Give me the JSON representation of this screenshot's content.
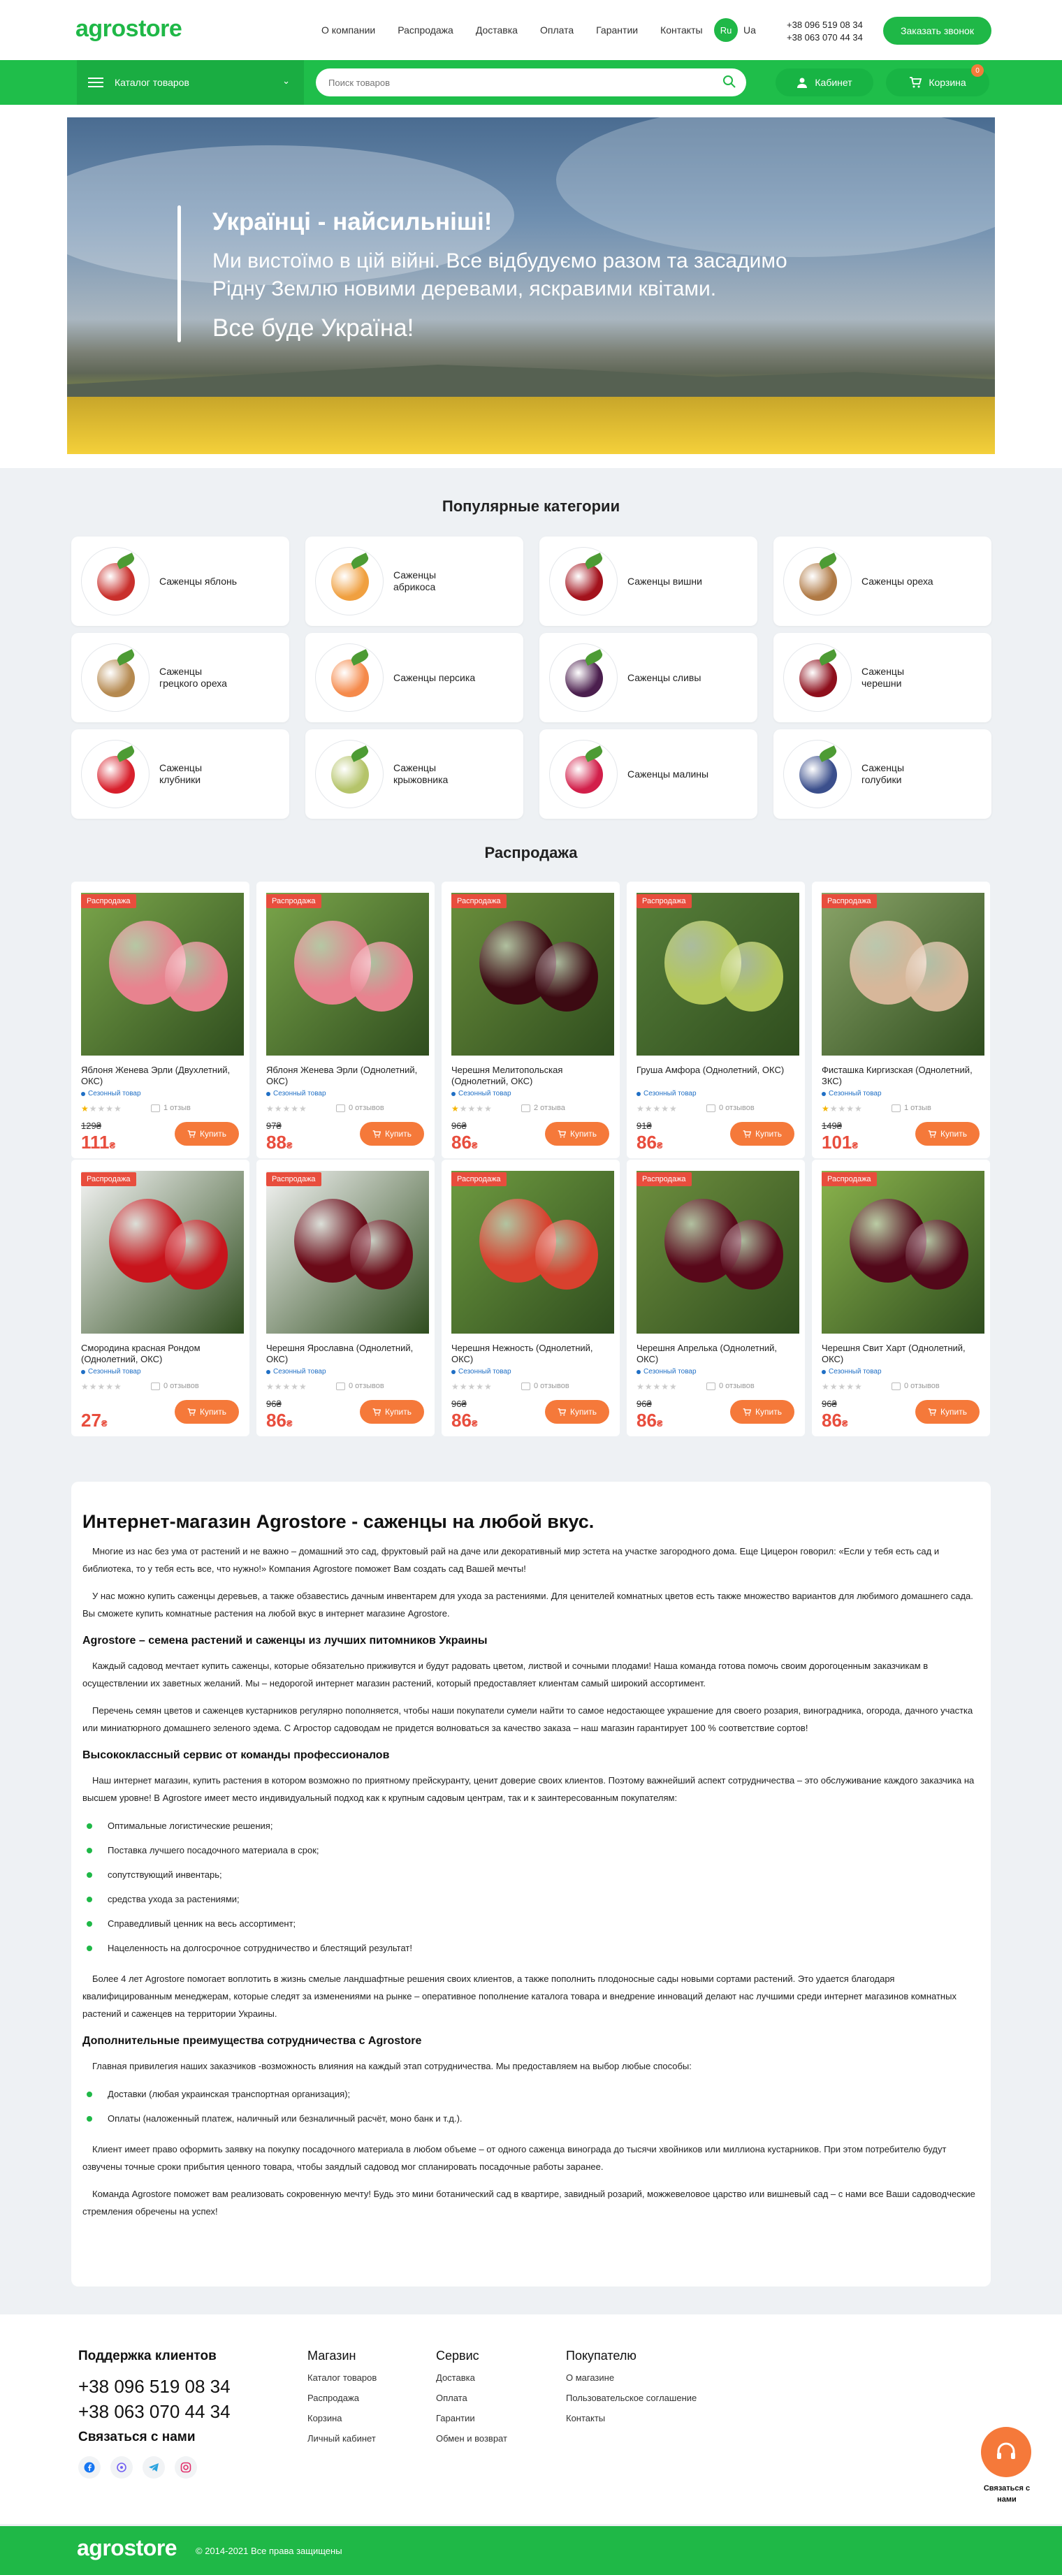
{
  "header": {
    "logo": "agrostore",
    "nav": [
      "О компании",
      "Распродажа",
      "Доставка",
      "Оплата",
      "Гарантии",
      "Контакты"
    ],
    "lang_ru": "Ru",
    "lang_ua": "Ua",
    "phone1": "+38 096 519 08 34",
    "phone2": "+38 063 070 44 34",
    "call_button": "Заказать звонок"
  },
  "bar": {
    "catalog": "Каталог товаров",
    "search_placeholder": "Поиск товаров",
    "cabinet": "Кабинет",
    "cart": "Корзина",
    "cart_count": "0"
  },
  "hero": {
    "title": "Українці - найсильніші!",
    "text": "Ми вистоїмо в цій війні. Все відбудуємо разом та засадимо Рідну Землю новими деревами, яскравими квітами.",
    "slogan": "Все буде Україна!"
  },
  "categories_title": "Популярные категории",
  "categories": [
    {
      "label": "Саженцы яблонь",
      "icon": "apple-icon",
      "color": "#c9302c"
    },
    {
      "label": "Саженцы абрикоса",
      "icon": "apricot-icon",
      "color": "#f0a040"
    },
    {
      "label": "Саженцы вишни",
      "icon": "cherry-icon",
      "color": "#a3121c"
    },
    {
      "label": "Саженцы ореха",
      "icon": "nut-icon",
      "color": "#b07a45"
    },
    {
      "label": "Саженцы грецкого ореха",
      "icon": "walnut-icon",
      "color": "#b5894f"
    },
    {
      "label": "Саженцы персика",
      "icon": "peach-icon",
      "color": "#f58a4b"
    },
    {
      "label": "Саженцы сливы",
      "icon": "plum-icon",
      "color": "#4b1f4e"
    },
    {
      "label": "Саженцы черешни",
      "icon": "sweet-cherry-icon",
      "color": "#8e0f1c"
    },
    {
      "label": "Саженцы клубники",
      "icon": "strawberry-icon",
      "color": "#d8202c"
    },
    {
      "label": "Саженцы крыжовника",
      "icon": "gooseberry-icon",
      "color": "#b5c46a"
    },
    {
      "label": "Саженцы малины",
      "icon": "raspberry-icon",
      "color": "#d21f4a"
    },
    {
      "label": "Саженцы голубики",
      "icon": "blueberry-icon",
      "color": "#3b4f8c"
    }
  ],
  "sale_title": "Распродажа",
  "products": [
    {
      "badge": "Распродажа",
      "name": "Яблоня Женева Эрли (Двухлетний, ОКС)",
      "season": "Сезонный товар",
      "reviews": "1 отзыв",
      "old": "129₴",
      "price": "111",
      "buy": "Купить",
      "fruit": "#e8838f",
      "bg": "#7aa54a",
      "rated": true
    },
    {
      "badge": "Распродажа",
      "name": "Яблоня Женева Эрли (Однолетний, ОКС)",
      "season": "Сезонный товар",
      "reviews": "0 отзывов",
      "old": "97₴",
      "price": "88",
      "buy": "Купить",
      "fruit": "#e8838f",
      "bg": "#7aa54a",
      "rated": false
    },
    {
      "badge": "Распродажа",
      "name": "Черешня Мелитопольская (Однолетний, ОКС)",
      "season": "Сезонный товар",
      "reviews": "2 отзыва",
      "old": "96₴",
      "price": "86",
      "buy": "Купить",
      "fruit": "#3c0a12",
      "bg": "#6b8f3c",
      "rated": true
    },
    {
      "badge": "Распродажа",
      "name": "Груша Амфора (Однолетний, ОКС)",
      "season": "Сезонный товар",
      "reviews": "0 отзывов",
      "old": "91₴",
      "price": "86",
      "buy": "Купить",
      "fruit": "#b4c85a",
      "bg": "#58803a",
      "rated": false
    },
    {
      "badge": "Распродажа",
      "name": "Фисташка Киргизская (Однолетний, ЗКС)",
      "season": "Сезонный товар",
      "reviews": "1 отзыв",
      "old": "149₴",
      "price": "101",
      "buy": "Купить",
      "fruit": "#d7b79a",
      "bg": "#8aa468",
      "rated": true
    },
    {
      "badge": "Распродажа",
      "name": "Смородина красная Рондом (Однолетний, ОКС)",
      "season": "Сезонный товар",
      "reviews": "0 отзывов",
      "old": "",
      "price": "27",
      "buy": "Купить",
      "fruit": "#c8141c",
      "bg": "#f4f4f4",
      "rated": false
    },
    {
      "badge": "Распродажа",
      "name": "Черешня Ярославна (Однолетний, ОКС)",
      "season": "Сезонный товар",
      "reviews": "0 отзывов",
      "old": "96₴",
      "price": "86",
      "buy": "Купить",
      "fruit": "#6b0a18",
      "bg": "#f4f4f4",
      "rated": false
    },
    {
      "badge": "Распродажа",
      "name": "Черешня Нежность (Однолетний, ОКС)",
      "season": "Сезонный товар",
      "reviews": "0 отзывов",
      "old": "96₴",
      "price": "86",
      "buy": "Купить",
      "fruit": "#d8412e",
      "bg": "#6f9b40",
      "rated": false
    },
    {
      "badge": "Распродажа",
      "name": "Черешня Апрелька (Однолетний, ОКС)",
      "season": "Сезонный товар",
      "reviews": "0 отзывов",
      "old": "96₴",
      "price": "86",
      "buy": "Купить",
      "fruit": "#58081a",
      "bg": "#6e8f3e",
      "rated": false
    },
    {
      "badge": "Распродажа",
      "name": "Черешня Свит Харт (Однолетний, ОКС)",
      "season": "Сезонный товар",
      "reviews": "0 отзывов",
      "old": "96₴",
      "price": "86",
      "buy": "Купить",
      "fruit": "#52081a",
      "bg": "#8ab34c",
      "rated": false
    }
  ],
  "currency": "₴",
  "article": {
    "h1": "Интернет-магазин Agrostore - саженцы на любой вкус.",
    "p1": "Многие из нас без ума от растений и не важно – домашний это сад, фруктовый рай на даче или декоративный мир эстета на участке загородного дома. Еще Цицерон говорил: «Если у тебя есть сад и библиотека, то у тебя есть все, что нужно!» Компания Agrostore поможет Вам создать сад Вашей мечты!",
    "p2": "У нас можно купить саженцы деревьев, а также обзавестись дачным инвентарем для ухода за растениями. Для ценителей комнатных цветов есть также множество вариантов для любимого домашнего сада. Вы сможете купить комнатные растения на любой вкус в интернет магазине Agrostore.",
    "h2": "Agrostore – семена растений и саженцы из лучших питомников Украины",
    "p3": "Каждый садовод мечтает купить саженцы, которые обязательно приживутся и будут радовать цветом, листвой и сочными плодами! Наша команда готова помочь своим дорогоценным заказчикам в осуществлении их заветных желаний. Мы – недорогой интернет магазин растений, который предоставляет клиентам самый широкий ассортимент.",
    "p4": "Перечень семян цветов и саженцев кустарников регулярно пополняется, чтобы наши покупатели сумели найти то самое недостающее украшение для своего розария, виноградника, огорода, дачного участка или миниатюрного домашнего зеленого эдема. С Агростор садоводам не придется волноваться за качество заказа – наш магазин гарантирует 100 % соответствие сортов!",
    "h3": "Высококлассный сервис от команды профессионалов",
    "p5": "Наш интернет магазин, купить растения в котором возможно по приятному прейскуранту, ценит доверие своих клиентов. Поэтому важнейший аспект сотрудничества – это обслуживание каждого заказчика на высшем уровне! В Agrostore имеет место индивидуальный подход как к крупным садовым центрам, так и к заинтересованным покупателям:",
    "list1": [
      "Оптимальные логистические решения;",
      "Поставка лучшего посадочного материала в срок;",
      "сопутствующий инвентарь;",
      "средства ухода за растениями;",
      "Справедливый ценник на весь ассортимент;",
      "Нацеленность на долгосрочное сотрудничество и блестящий результат!"
    ],
    "p6": "Более 4 лет Agrostore помогает воплотить в жизнь смелые ландшафтные решения своих клиентов, а также пополнить плодоносные сады новыми сортами растений. Это удается благодаря квалифицированным менеджерам, которые следят за изменениями на рынке – оперативное пополнение каталога товара и внедрение инноваций делают нас лучшими среди интернет магазинов комнатных растений и саженцев на территории Украины.",
    "h4": "Дополнительные преимущества сотрудничества с Agrostore",
    "p7": "Главная привилегия наших заказчиков -возможность влияния на каждый этап сотрудничества. Мы предоставляем на выбор любые способы:",
    "list2": [
      "Доставки (любая украинская транспортная организация);",
      "Оплаты (наложенный платеж, наличный или безналичный расчёт, моно банк и т.д.)."
    ],
    "p8": "Клиент имеет право оформить заявку на покупку посадочного материала в любом объеме – от одного саженца винограда до тысячи хвойников или миллиона кустарников. При этом потребителю будут озвучены точные сроки прибытия ценного товара, чтобы заядлый садовод мог спланировать посадочные работы заранее.",
    "p9": "Команда Agrostore поможет вам реализовать сокровенную мечту! Будь это мини ботанический сад в квартире, завидный розарий, можжевеловое царство или вишневый сад – с нами все Ваши садоводческие стремления обречены на успех!"
  },
  "footer": {
    "support_title": "Поддержка клиентов",
    "phone1": "+38 096 519 08 34",
    "phone2": "+38 063 070 44 34",
    "contact_title": "Связаться с нами",
    "social": [
      "facebook-icon",
      "viber-icon",
      "telegram-icon",
      "instagram-icon"
    ],
    "shop_title": "Магазин",
    "shop_links": [
      "Каталог товаров",
      "Распродажа",
      "Корзина",
      "Личный кабинет"
    ],
    "service_title": "Сервис",
    "service_links": [
      "Доставка",
      "Оплата",
      "Гарантии",
      "Обмен и возврат"
    ],
    "buyer_title": "Покупателю",
    "buyer_links": [
      "О магазине",
      "Пользовательское соглашение",
      "Контакты"
    ],
    "chat_label": "Связаться с нами",
    "logo": "agrostore",
    "copyright": "© 2014-2021 Все права защищены",
    "brand_color": "#1fb847",
    "accent_color": "#f5793a",
    "sale_color": "#e84d3d"
  }
}
